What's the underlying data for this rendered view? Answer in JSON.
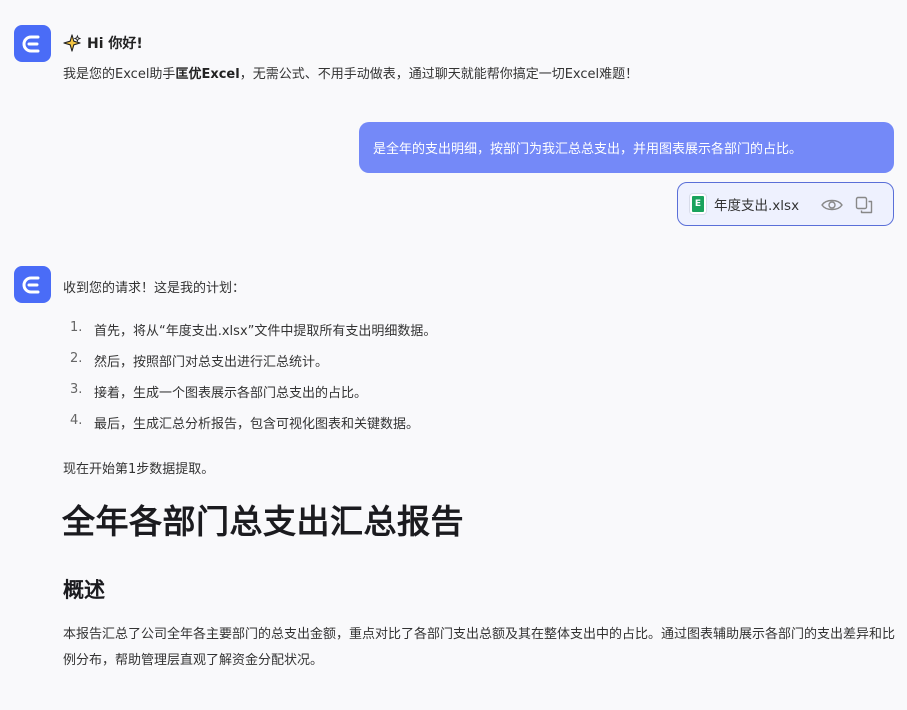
{
  "greeting": {
    "title": "Hi 你好!",
    "text_before": "我是您的Excel助手",
    "assistant_name": "匡优Excel",
    "text_after": "，无需公式、不用手动做表，通过聊天就能帮你搞定一切Excel难题！"
  },
  "user_message": {
    "text": "是全年的支出明细，按部门为我汇总总支出，并用图表展示各部门的占比。",
    "attachment": {
      "icon_letter": "E",
      "file_name": "年度支出.xlsx",
      "actions": [
        "eye-icon",
        "copy-icon"
      ]
    }
  },
  "assistant_reply": {
    "intro": "收到您的请求！这是我的计划：",
    "plan": [
      {
        "num": "1.",
        "text": "首先，将从“年度支出.xlsx”文件中提取所有支出明细数据。"
      },
      {
        "num": "2.",
        "text": "然后，按照部门对总支出进行汇总统计。"
      },
      {
        "num": "3.",
        "text": "接着，生成一个图表展示各部门总支出的占比。"
      },
      {
        "num": "4.",
        "text": "最后，生成汇总分析报告，包含可视化图表和关键数据。"
      }
    ],
    "start_line": "现在开始第1步数据提取。",
    "report_title": "全年各部门总支出汇总报告",
    "section_title": "概述",
    "summary": "本报告汇总了公司全年各主要部门的总支出金额，重点对比了各部门支出总额及其在整体支出中的占比。通过图表辅助展示各部门的支出差异和比例分布，帮助管理层直观了解资金分配状况。"
  },
  "colors": {
    "avatar": "#4a6cf7",
    "user_bubble": "#7489f8",
    "file_icon": "#1aa35c"
  }
}
